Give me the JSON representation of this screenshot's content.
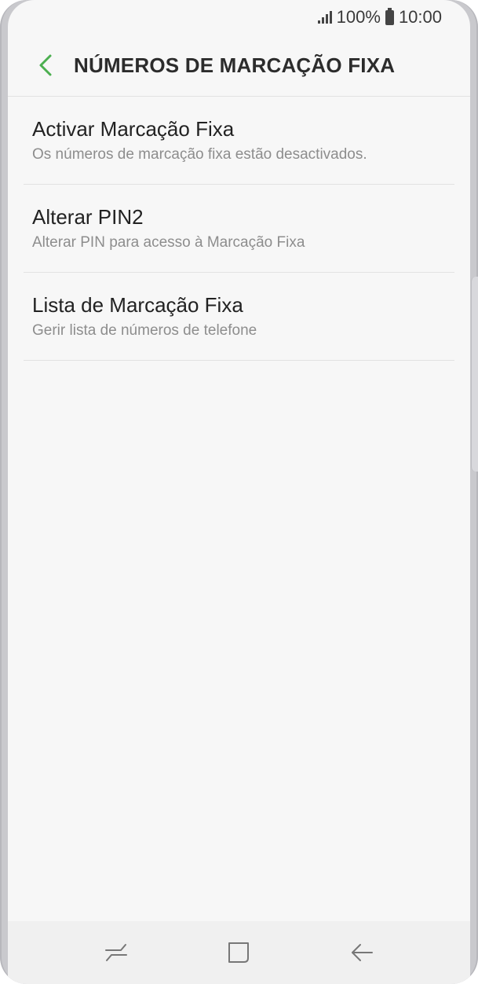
{
  "status_bar": {
    "battery": "100%",
    "time": "10:00",
    "signal_icon": "signal-icon",
    "battery_icon": "battery-icon"
  },
  "header": {
    "title": "NÚMEROS DE MARCAÇÃO FIXA",
    "back_icon": "chevron-left-icon",
    "accent_color": "#4caf50"
  },
  "list": {
    "items": [
      {
        "title": "Activar Marcação Fixa",
        "subtitle": "Os números de marcação fixa estão desactivados."
      },
      {
        "title": "Alterar PIN2",
        "subtitle": "Alterar PIN para acesso à Marcação Fixa"
      },
      {
        "title": "Lista de Marcação Fixa",
        "subtitle": "Gerir lista de números de telefone"
      }
    ]
  },
  "nav_bar": {
    "recents_icon": "recents-icon",
    "home_icon": "home-icon",
    "back_icon": "back-arrow-icon"
  }
}
